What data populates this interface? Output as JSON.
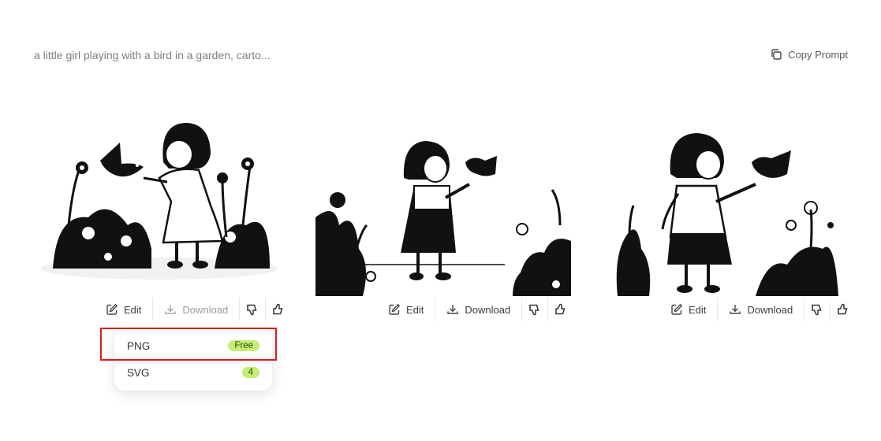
{
  "prompt": "a little girl playing with a bird in a garden, carto...",
  "copy_prompt_label": "Copy Prompt",
  "images": [
    {
      "alt": "girl in white dress with bird and flowers",
      "toolbar": {
        "edit_label": "Edit",
        "download_label": "Download",
        "download_state": "disabled"
      }
    },
    {
      "alt": "girl in dark dress holding bird in garden",
      "toolbar": {
        "edit_label": "Edit",
        "download_label": "Download"
      }
    },
    {
      "alt": "girl with bag holding bird among plants",
      "toolbar": {
        "edit_label": "Edit",
        "download_label": "Download"
      }
    }
  ],
  "download_menu": {
    "options": [
      {
        "label": "PNG",
        "badge": "Free",
        "highlighted": true
      },
      {
        "label": "SVG",
        "badge": "4"
      }
    ]
  },
  "icons": {
    "copy": "copy-icon",
    "edit": "edit-icon",
    "download": "download-icon",
    "dislike": "thumbs-down-icon",
    "like": "thumbs-up-icon"
  },
  "colors": {
    "badge_bg": "#c3ef73",
    "highlight_border": "#e01b1b"
  }
}
